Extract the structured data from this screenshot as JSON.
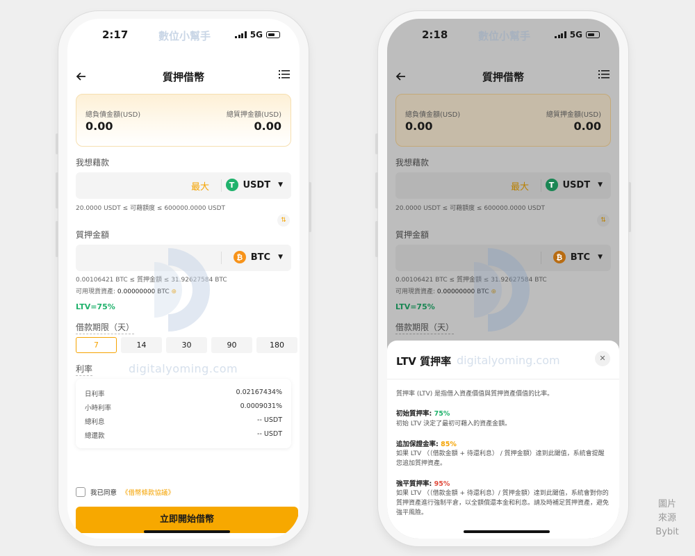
{
  "left_phone": {
    "time": "2:17",
    "network": "5G",
    "watermark_top": "數位小幫手",
    "nav_title": "質押借幣",
    "summary": {
      "debt_label": "總負債金額(USD)",
      "debt_value": "0.00",
      "collateral_label": "總質押金額(USD)",
      "collateral_value": "0.00"
    },
    "borrow": {
      "label": "我想藉款",
      "max_label": "最大",
      "coin": "USDT",
      "coin_symbol": "T",
      "range": "20.0000 USDT ≤ 可藉額度 ≤ 600000.0000 USDT"
    },
    "collateral": {
      "label": "質押金額",
      "coin": "BTC",
      "coin_symbol": "₿",
      "range": "0.00106421 BTC ≤ 質押金額 ≤ 31.92627584 BTC",
      "available_label": "可用現貨資產:",
      "available_value": "0.00000000 BTC"
    },
    "ltv": "LTV=75%",
    "term": {
      "label": "借款期限（天）",
      "options": [
        "7",
        "14",
        "30",
        "90",
        "180"
      ]
    },
    "rate": {
      "label": "利率",
      "rows": [
        {
          "label": "日利率",
          "value": "0.02167434%"
        },
        {
          "label": "小時利率",
          "value": "0.0009031%"
        },
        {
          "label": "總利息",
          "value": "-- USDT"
        },
        {
          "label": "總還款",
          "value": "-- USDT"
        }
      ]
    },
    "agree_text": "我已同意",
    "agree_link": "《借幣條款協議》",
    "start_button": "立即開始借幣",
    "watermark_text": "digitalyoming.com"
  },
  "right_phone": {
    "time": "2:18",
    "network": "5G",
    "watermark_top": "數位小幫手",
    "nav_title": "質押借幣",
    "summary": {
      "debt_label": "總負債金額(USD)",
      "debt_value": "0.00",
      "collateral_label": "總質押金額(USD)",
      "collateral_value": "0.00"
    },
    "borrow": {
      "label": "我想藉款",
      "max_label": "最大",
      "coin": "USDT",
      "coin_symbol": "T",
      "range": "20.0000 USDT ≤ 可藉額度 ≤ 600000.0000 USDT"
    },
    "collateral": {
      "label": "質押金額",
      "coin": "BTC",
      "coin_symbol": "₿",
      "range": "0.00106421 BTC ≤ 質押金額 ≤ 31.92627584 BTC",
      "available_label": "可用現貨資產:",
      "available_value": "0.00000000 BTC"
    },
    "ltv": "LTV=75%",
    "term_label": "借款期限（天）",
    "sheet": {
      "title": "LTV 質押率",
      "watermark": "digitalyoming.com",
      "intro": "質押率 (LTV) 是指借入資產價值與質押資產價值的比率。",
      "initial_title": "初始質押率:",
      "initial_value": "75%",
      "initial_desc": "初始 LTV 決定了最初可藉入的資產金額。",
      "margin_title": "追加保證金率:",
      "margin_value": "85%",
      "margin_desc": "如果 LTV （（借款金額 + 待還利息） / 質押金額）達到此閾值，系統會提醒您追加質押資產。",
      "liq_title": "強平質押率:",
      "liq_value": "95%",
      "liq_desc": "如果 LTV （（借款金額 + 待還利息）/ 質押金額）達到此閾值，系統會對你的質押資產進行強制平倉，以全額償還本金和利息。請及時補足質押資產，避免強平風險。"
    }
  },
  "credit": {
    "line1": "圖片",
    "line2": "來源",
    "line3": "Bybit"
  },
  "colors": {
    "accent": "#f7a800",
    "green": "#20b26c",
    "red": "#e04b3c"
  }
}
